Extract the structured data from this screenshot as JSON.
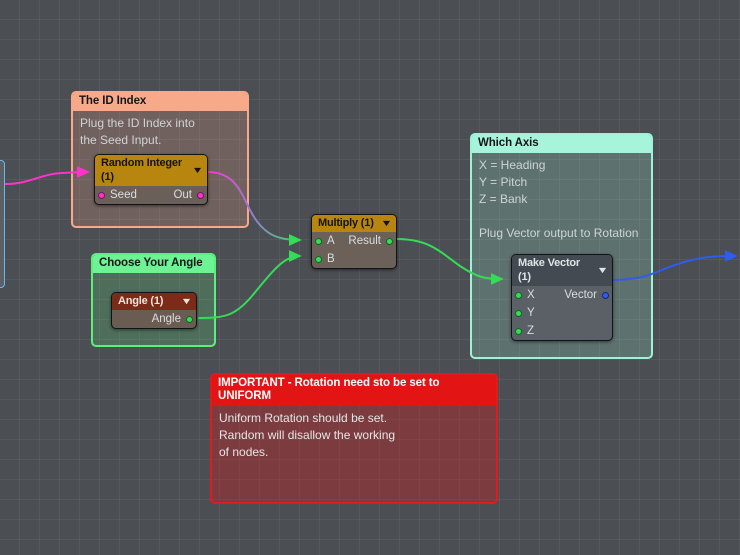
{
  "app": {
    "title": "Node Graph Editor Canvas",
    "background_color": "#4b4e53",
    "grid_color": "#5a5d62"
  },
  "groups": [
    {
      "id": "id-index",
      "title": "The ID Index",
      "color": "#f7a989",
      "lines": [
        "Plug the ID Index into",
        "the Seed Input."
      ]
    },
    {
      "id": "choose-angle",
      "title": "Choose Your Angle",
      "color": "#6df294",
      "lines": []
    },
    {
      "id": "which-axis",
      "title": "Which Axis",
      "color": "#a6f5da",
      "lines": [
        "X = Heading",
        "Y = Pitch",
        "Z = Bank",
        "",
        "Plug Vector output to Rotation"
      ]
    },
    {
      "id": "important",
      "title": "IMPORTANT - Rotation need sto be set to UNIFORM",
      "color": "#e31414",
      "lines": [
        "Uniform Rotation should be set.",
        "Random will disallow the working",
        "of nodes."
      ]
    }
  ],
  "nodes": [
    {
      "id": "random-integer",
      "title": "Random Integer (1)",
      "header_color": "#b8860f",
      "collapse_icon": "chevron-down-icon",
      "inputs": [
        {
          "label": "Seed",
          "port_color": "#ff33cc"
        }
      ],
      "outputs": [
        {
          "label": "Out",
          "port_color": "#ff33cc"
        }
      ]
    },
    {
      "id": "angle",
      "title": "Angle (1)",
      "header_color": "#7d2a18",
      "collapse_icon": "chevron-down-icon",
      "inputs": [],
      "outputs": [
        {
          "label": "Angle",
          "port_color": "#33dd55"
        }
      ]
    },
    {
      "id": "multiply",
      "title": "Multiply (1)",
      "header_color": "#b8860f",
      "collapse_icon": "chevron-down-icon",
      "inputs": [
        {
          "label": "A",
          "port_color": "#33dd55"
        },
        {
          "label": "B",
          "port_color": "#33dd55"
        }
      ],
      "outputs": [
        {
          "label": "Result",
          "port_color": "#33dd55"
        }
      ]
    },
    {
      "id": "make-vector",
      "title": "Make Vector (1)",
      "header_color": "#434a52",
      "collapse_icon": "chevron-down-icon",
      "inputs": [
        {
          "label": "X",
          "port_color": "#33dd55"
        },
        {
          "label": "Y",
          "port_color": "#33dd55"
        },
        {
          "label": "Z",
          "port_color": "#33dd55"
        }
      ],
      "outputs": [
        {
          "label": "Vector",
          "port_color": "#2f5cf0"
        }
      ]
    }
  ],
  "wires": [
    {
      "id": "wire-into-seed",
      "from": "offscreen-node",
      "to": "random-integer.Seed",
      "color_start": "#ff33cc",
      "color_end": "#ff33cc"
    },
    {
      "id": "wire-out-to-multiply-a",
      "from": "random-integer.Out",
      "to": "multiply.A",
      "color_start": "#ff33cc",
      "color_end": "#33dd55"
    },
    {
      "id": "wire-angle-to-multiply-b",
      "from": "angle.Angle",
      "to": "multiply.B",
      "color_start": "#33dd55",
      "color_end": "#33dd55"
    },
    {
      "id": "wire-result-to-vector-x",
      "from": "multiply.Result",
      "to": "make-vector.X",
      "color_start": "#33dd55",
      "color_end": "#33dd55"
    },
    {
      "id": "wire-vector-out",
      "from": "make-vector.Vector",
      "to": "offscreen-right",
      "color_start": "#2f5cf0",
      "color_end": "#2f5cf0"
    }
  ]
}
